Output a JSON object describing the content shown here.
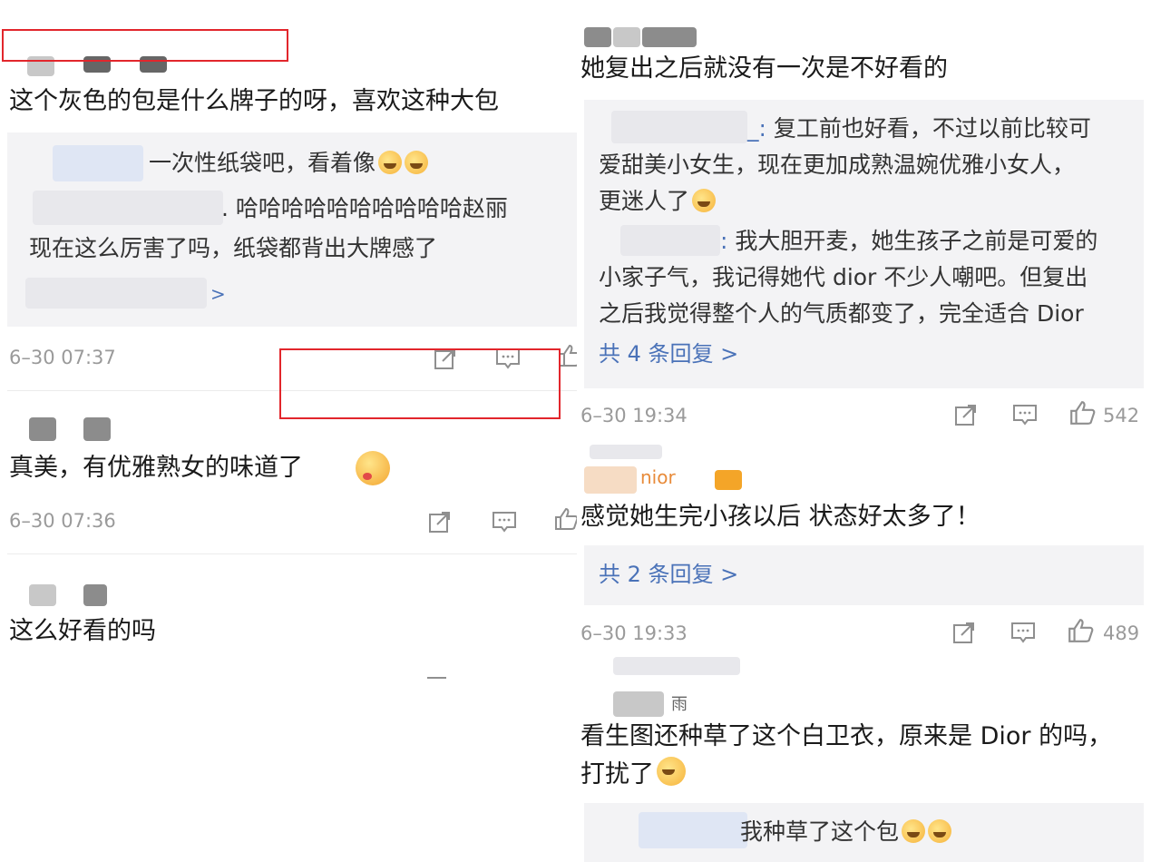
{
  "left": {
    "c1": {
      "text": "这个灰色的包是什么牌子的呀，喜欢这种大包",
      "reply1": "一次性纸袋吧，看着像",
      "reply2_a": ". 哈哈哈哈哈哈哈哈哈哈赵丽",
      "reply2_b": "现在这么厉害了吗，纸袋都背出大牌感了",
      "more": ">",
      "time": "6–30 07:37"
    },
    "c2": {
      "text": "真美，有优雅熟女的味道了",
      "time": "6–30 07:36"
    },
    "c3": {
      "text": "这么好看的吗"
    }
  },
  "right": {
    "c1": {
      "text": "她复出之后就没有一次是不好看的",
      "r1_prefix": "_: ",
      "r1_a": "复工前也好看，不过以前比较可",
      "r1_b": "爱甜美小女生，现在更加成熟温婉优雅小女人，",
      "r1_c": "更迷人了",
      "r2_prefix": ": ",
      "r2_a": "我大胆开麦，她生孩子之前是可爱的",
      "r2_b": "小家子气，我记得她代 dior 不少人嘲吧。但复出",
      "r2_c": "之后我觉得整个人的气质都变了，完全适合 Dior",
      "more": "共 4 条回复 >",
      "time": "6–30 19:34",
      "likes": "542"
    },
    "c2": {
      "user": "nior",
      "text": "感觉她生完小孩以后 状态好太多了！",
      "more": "共 2 条回复 >",
      "time": "6–30 19:33",
      "likes": "489"
    },
    "c3": {
      "user": "雨",
      "text_a": "看生图还种草了这个白卫衣，原来是 Dior 的吗，",
      "text_b": "打扰了",
      "reply": "我种草了这个包"
    }
  },
  "colors": {
    "link": "#4a72b8",
    "highlight": "#e2262c",
    "meta": "#9a9a9a",
    "panel": "#f3f3f5"
  },
  "icons": [
    "share-icon",
    "comment-icon",
    "like-icon"
  ]
}
